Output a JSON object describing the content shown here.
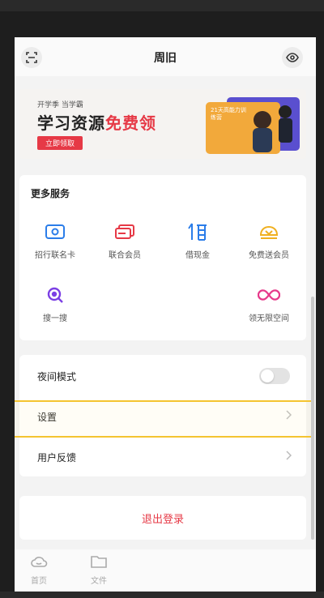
{
  "header": {
    "title": "周旧"
  },
  "banner": {
    "small_text": "开学季 当学霸",
    "headline_prefix": "学习资源",
    "headline_accent": "免费领",
    "cta": "立即领取",
    "card_text": "21天高能力训练营"
  },
  "services": {
    "title": "更多服务",
    "items": [
      {
        "label": "招行联名卡",
        "icon": "bank-card-icon",
        "color": "#2b7de9"
      },
      {
        "label": "联合会员",
        "icon": "member-card-icon",
        "color": "#e63946"
      },
      {
        "label": "借现金",
        "icon": "borrow-icon",
        "color": "#2b7de9"
      },
      {
        "label": "免费送会员",
        "icon": "gift-member-icon",
        "color": "#f0b020"
      },
      {
        "label": "搜一搜",
        "icon": "search-icon",
        "color": "#7b3fe4"
      },
      {
        "label": "领无限空间",
        "icon": "infinity-icon",
        "color": "#e6398a"
      }
    ]
  },
  "settings": {
    "night_mode": "夜间模式",
    "settings": "设置",
    "feedback": "用户反馈"
  },
  "logout": "退出登录",
  "tabs": [
    {
      "label": "首页",
      "icon": "cloud-icon"
    },
    {
      "label": "文件",
      "icon": "folder-icon"
    }
  ]
}
